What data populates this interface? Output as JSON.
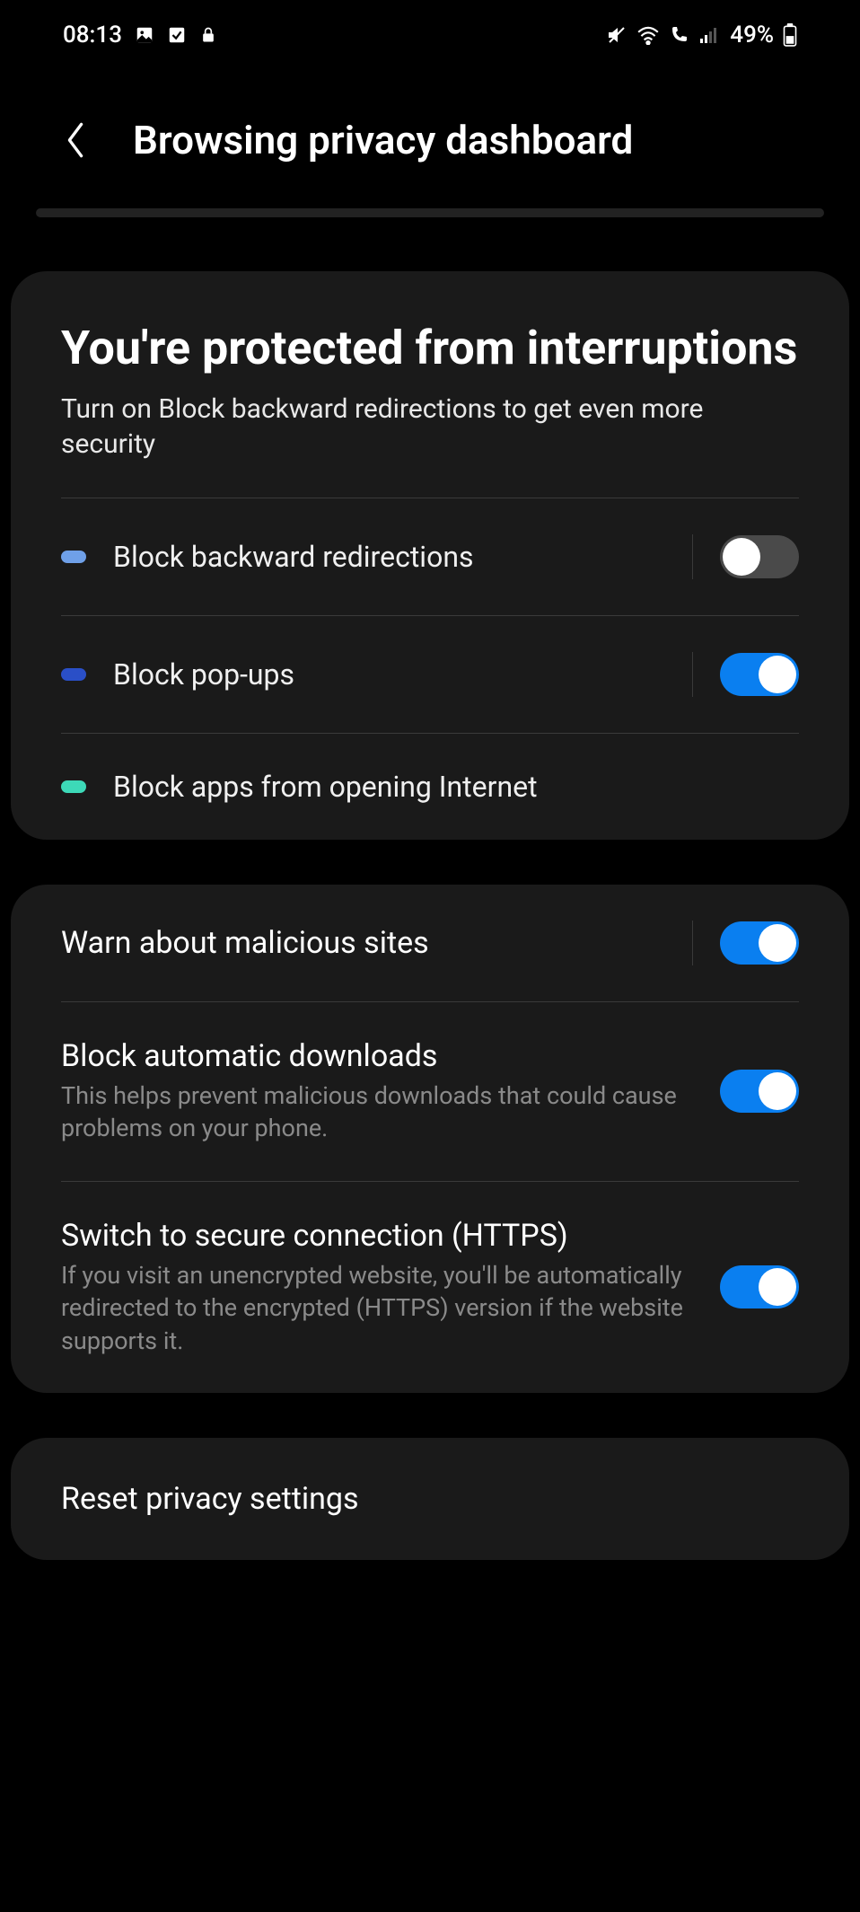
{
  "status": {
    "time": "08:13",
    "battery": "49%"
  },
  "header": {
    "title": "Browsing privacy dashboard"
  },
  "protection": {
    "title": "You're protected from interruptions",
    "subtitle": "Turn on Block backward redirections to get even more security",
    "items": [
      {
        "label": "Block backward redirections",
        "pill": "lightblue",
        "toggle": "off"
      },
      {
        "label": "Block pop-ups",
        "pill": "blue",
        "toggle": "on"
      },
      {
        "label": "Block apps from opening Internet",
        "pill": "teal",
        "toggle": null
      }
    ]
  },
  "security": {
    "items": [
      {
        "label": "Warn about malicious sites",
        "desc": null,
        "toggle": "on"
      },
      {
        "label": "Block automatic downloads",
        "desc": "This helps prevent malicious downloads that could cause problems on your phone.",
        "toggle": "on"
      },
      {
        "label": "Switch to secure connection (HTTPS)",
        "desc": "If you visit an unencrypted website, you'll be automatically redirected to the encrypted (HTTPS) version if the website supports it.",
        "toggle": "on"
      }
    ]
  },
  "reset": {
    "label": "Reset privacy settings"
  }
}
